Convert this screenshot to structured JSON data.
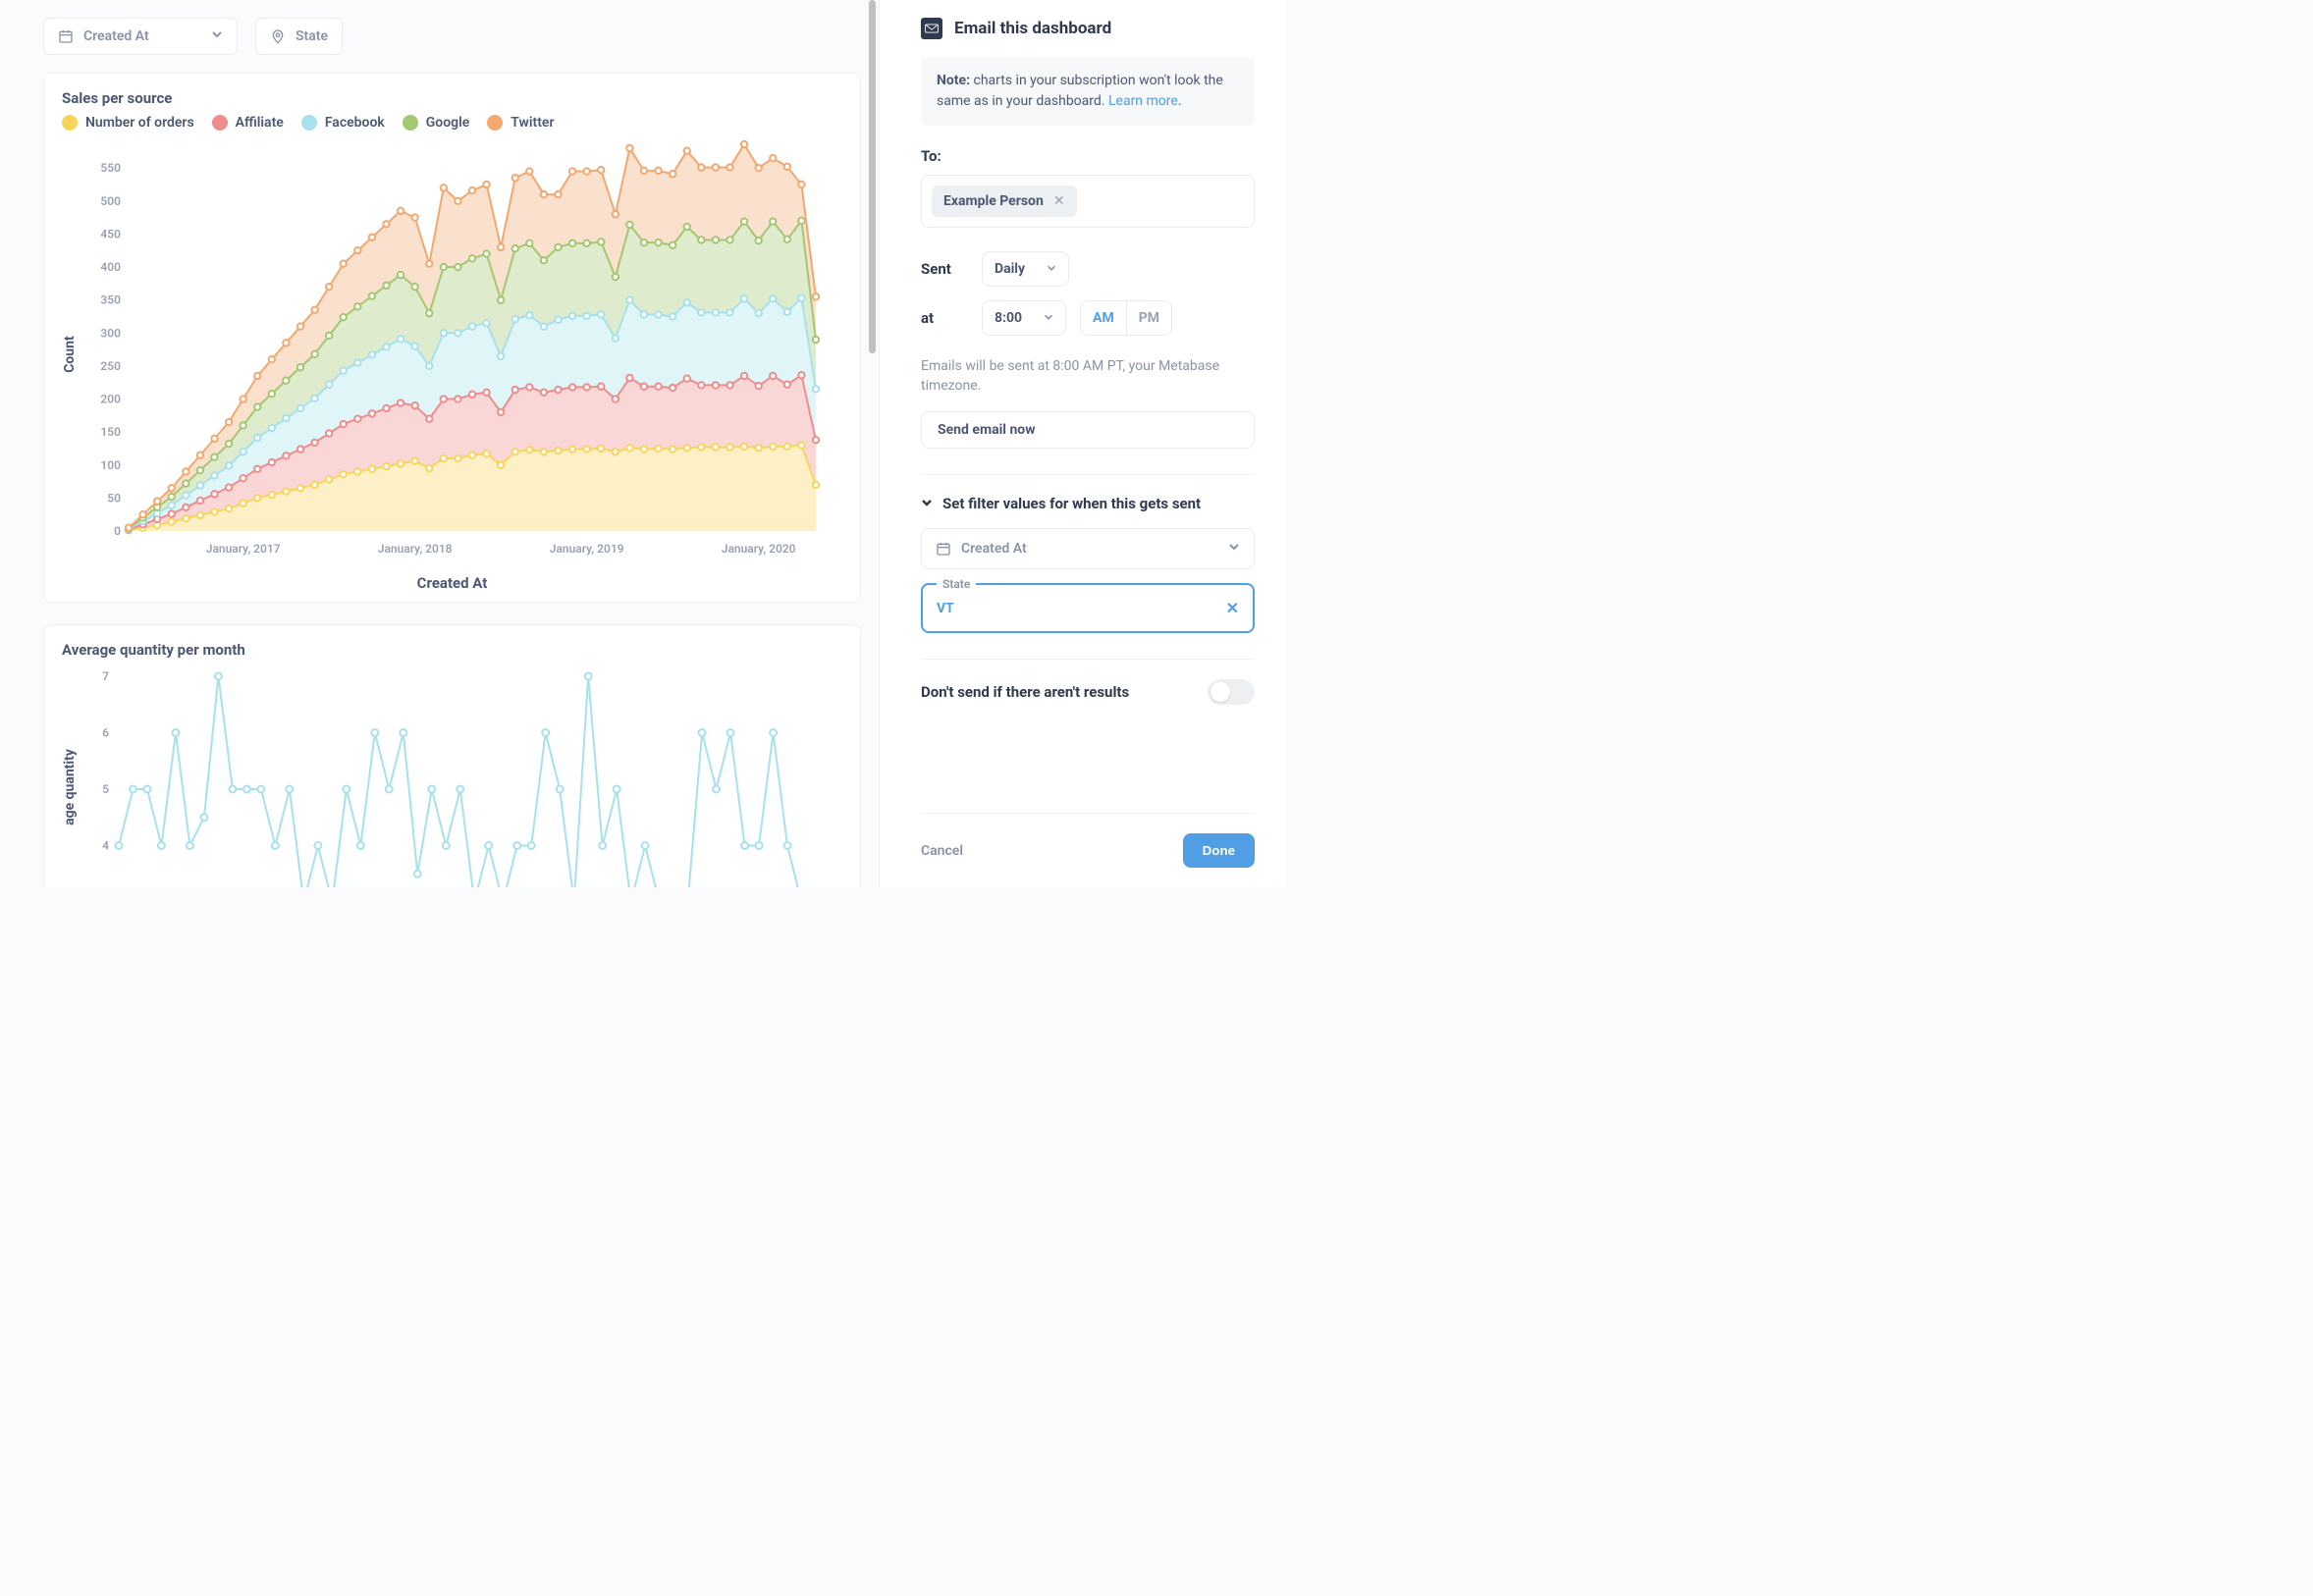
{
  "colors": {
    "yellow": "#f9d45c",
    "red": "#ef8c8c",
    "cyan": "#a6e1ec",
    "green": "#a4c771",
    "orange": "#f2a86f",
    "blue": "#509ee3",
    "text": "#4c5773",
    "muted": "#8a93a6"
  },
  "filters": {
    "date_label": "Created At",
    "state_label": "State"
  },
  "chart1": {
    "title": "Sales per source",
    "xlabel": "Created At",
    "ylabel": "Count",
    "legend": [
      {
        "label": "Number of orders",
        "color": "yellow"
      },
      {
        "label": "Affiliate",
        "color": "red"
      },
      {
        "label": "Facebook",
        "color": "cyan"
      },
      {
        "label": "Google",
        "color": "green"
      },
      {
        "label": "Twitter",
        "color": "orange"
      }
    ],
    "x_ticks": [
      "January, 2017",
      "January, 2018",
      "January, 2019",
      "January, 2020"
    ]
  },
  "chart2": {
    "title": "Average quantity per month",
    "ylabel": "age quantity"
  },
  "side": {
    "title": "Email this dashboard",
    "note_strong": "Note:",
    "note_text": "charts in your subscription won't look the same as in your dashboard.",
    "learn_more": "Learn more",
    "to_label": "To:",
    "recipient": "Example Person",
    "sent_label": "Sent",
    "freq": "Daily",
    "at_label": "at",
    "time": "8:00",
    "am": "AM",
    "pm": "PM",
    "send_hint": "Emails will be sent at 8:00 AM PT, your Metabase timezone.",
    "send_now": "Send email now",
    "filter_section": "Set filter values for when this gets sent",
    "filter_date": "Created At",
    "state_label": "State",
    "state_value": "VT",
    "dont_send": "Don't send if there aren't results",
    "cancel": "Cancel",
    "done": "Done"
  },
  "chart_data": [
    {
      "type": "area",
      "title": "Sales per source",
      "xlabel": "Created At",
      "ylabel": "Count",
      "ylim": [
        0,
        580
      ],
      "y_ticks": [
        0,
        50,
        100,
        150,
        200,
        250,
        300,
        350,
        400,
        450,
        500,
        550
      ],
      "x_tick_labels": [
        "January, 2017",
        "January, 2018",
        "January, 2019",
        "January, 2020"
      ],
      "x_tick_indices": [
        8,
        20,
        32,
        44
      ],
      "n_points": 49,
      "stacked": true,
      "series": [
        {
          "name": "Number of orders",
          "values_stacked_top": [
            1,
            5,
            9,
            14,
            19,
            24,
            29,
            34,
            42,
            50,
            55,
            60,
            65,
            70,
            78,
            86,
            90,
            94,
            98,
            102,
            106,
            95,
            110,
            110,
            115,
            117,
            100,
            120,
            123,
            120,
            122,
            124,
            124,
            125,
            120,
            126,
            124,
            125,
            124,
            126,
            127,
            127,
            127,
            128,
            126,
            128,
            128,
            130,
            70
          ]
        },
        {
          "name": "Affiliate",
          "values_stacked_top": [
            2,
            10,
            18,
            26,
            36,
            46,
            56,
            66,
            80,
            94,
            104,
            114,
            124,
            134,
            148,
            162,
            170,
            178,
            186,
            194,
            190,
            170,
            200,
            200,
            207,
            210,
            180,
            214,
            218,
            210,
            214,
            218,
            218,
            219,
            200,
            232,
            219,
            219,
            217,
            231,
            221,
            221,
            221,
            235,
            220,
            235,
            222,
            236,
            138
          ]
        },
        {
          "name": "Facebook",
          "values_stacked_top": [
            3,
            15,
            27,
            39,
            54,
            69,
            84,
            99,
            120,
            141,
            156,
            171,
            186,
            201,
            222,
            243,
            255,
            267,
            279,
            291,
            280,
            250,
            300,
            300,
            310,
            315,
            265,
            321,
            327,
            310,
            320,
            326,
            326,
            328,
            292,
            350,
            328,
            328,
            325,
            346,
            331,
            331,
            331,
            352,
            330,
            352,
            332,
            353,
            215
          ]
        },
        {
          "name": "Google",
          "values_stacked_top": [
            4,
            20,
            36,
            52,
            72,
            92,
            112,
            132,
            160,
            188,
            208,
            228,
            248,
            268,
            296,
            324,
            340,
            356,
            372,
            388,
            370,
            330,
            400,
            400,
            413,
            420,
            350,
            428,
            436,
            410,
            430,
            436,
            436,
            438,
            385,
            464,
            437,
            437,
            433,
            461,
            441,
            441,
            441,
            469,
            440,
            469,
            442,
            470,
            290
          ]
        },
        {
          "name": "Twitter",
          "values_stacked_top": [
            5,
            25,
            45,
            65,
            90,
            115,
            140,
            165,
            200,
            235,
            260,
            285,
            310,
            335,
            370,
            405,
            425,
            445,
            465,
            485,
            475,
            405,
            520,
            500,
            516,
            525,
            430,
            535,
            545,
            510,
            510,
            545,
            545,
            547,
            480,
            580,
            546,
            546,
            541,
            576,
            551,
            551,
            551,
            586,
            550,
            565,
            552,
            525,
            355
          ]
        }
      ]
    },
    {
      "type": "line",
      "title": "Average quantity per month",
      "ylabel": "Average quantity",
      "ylim": [
        3,
        7
      ],
      "x_visible": false,
      "series": [
        {
          "name": "Average quantity",
          "values": [
            4,
            5,
            5,
            4,
            6,
            4,
            4.5,
            7,
            5,
            5,
            5,
            4,
            5,
            3,
            4,
            3,
            5,
            4,
            6,
            5,
            6,
            3.5,
            5,
            4,
            5,
            3,
            4,
            3,
            4,
            4,
            6,
            5,
            3,
            7,
            4,
            5,
            3,
            4,
            3,
            3,
            3,
            6,
            5,
            6,
            4,
            4,
            6,
            4,
            3,
            3
          ]
        }
      ]
    }
  ]
}
